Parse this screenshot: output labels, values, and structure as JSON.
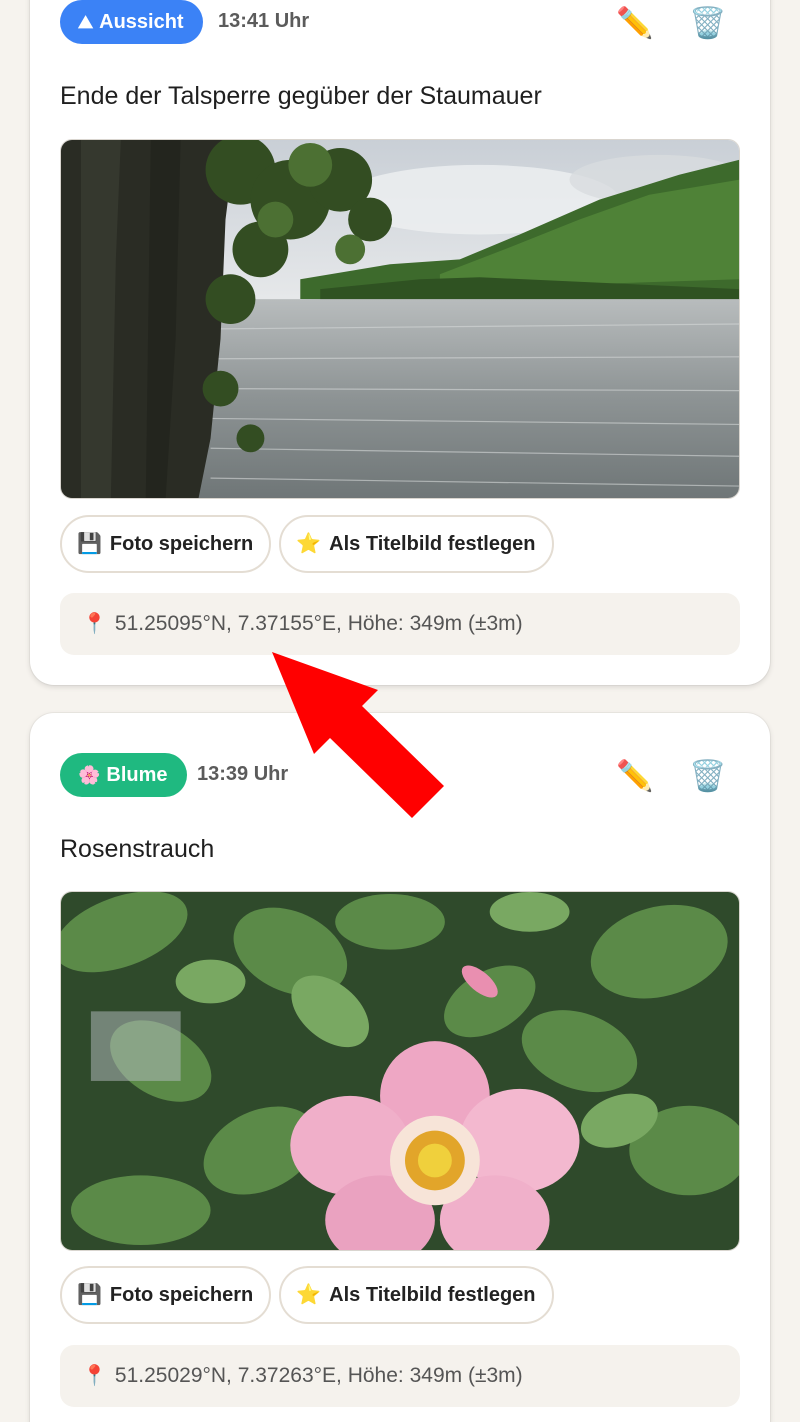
{
  "entries": [
    {
      "category": {
        "label": "Aussicht",
        "icon": "mountain-icon",
        "icon_glyph": "⛰",
        "color": "#3b82f6"
      },
      "time": "13:41 Uhr",
      "title": "Ende der Talsperre gegüber der Staumauer",
      "photo": {
        "subject": "lake-with-tree-photo"
      },
      "actions": {
        "save_icon": "💾",
        "save_label": "Foto speichern",
        "cover_icon": "⭐",
        "cover_label": "Als Titelbild festlegen",
        "edit_icon": "✏️",
        "delete_icon": "🗑️"
      },
      "location": {
        "pin_icon": "📍",
        "text": "51.25095°N, 7.37155°E, Höhe: 349m (±3m)"
      }
    },
    {
      "category": {
        "label": "Blume",
        "icon": "flower-icon",
        "icon_glyph": "🌸",
        "color": "#1fb980"
      },
      "time": "13:39 Uhr",
      "title": "Rosenstrauch",
      "photo": {
        "subject": "wild-rose-photo"
      },
      "actions": {
        "save_icon": "💾",
        "save_label": "Foto speichern",
        "cover_icon": "⭐",
        "cover_label": "Als Titelbild festlegen",
        "edit_icon": "✏️",
        "delete_icon": "🗑️"
      },
      "location": {
        "pin_icon": "📍",
        "text": "51.25029°N, 7.37263°E, Höhe: 349m (±3m)"
      }
    }
  ],
  "annotation": {
    "type": "arrow",
    "color": "#ff0000",
    "points_to": "location-text"
  }
}
